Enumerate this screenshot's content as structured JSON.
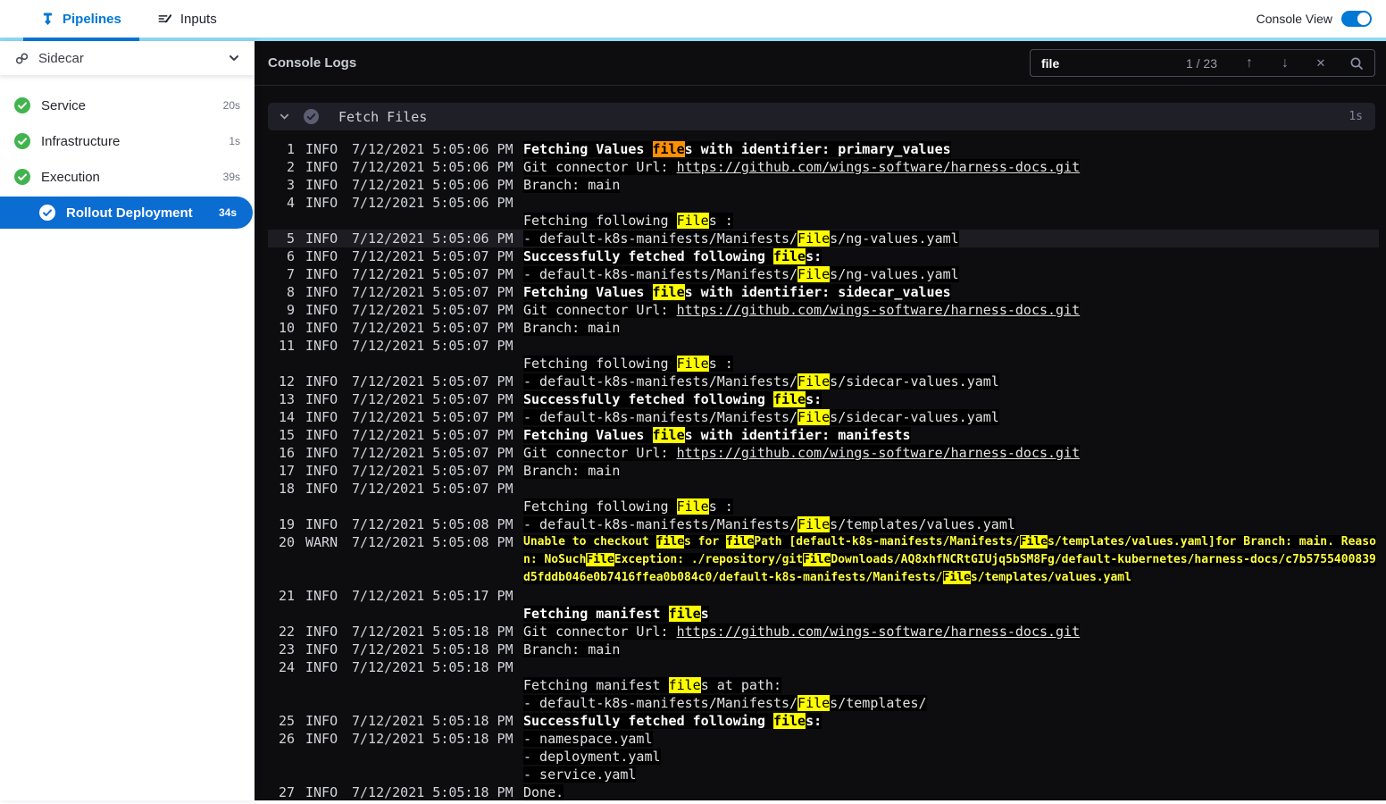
{
  "topbar": {
    "tabs": [
      {
        "label": "Pipelines",
        "active": true
      },
      {
        "label": "Inputs",
        "active": false
      }
    ],
    "console_view_label": "Console View",
    "console_view_on": true
  },
  "sidebar": {
    "group": {
      "label": "Sidecar"
    },
    "items": [
      {
        "label": "Service",
        "duration": "20s",
        "status": "success"
      },
      {
        "label": "Infrastructure",
        "duration": "1s",
        "status": "success"
      },
      {
        "label": "Execution",
        "duration": "39s",
        "status": "success"
      }
    ],
    "selected_item": {
      "label": "Rollout Deployment",
      "duration": "34s",
      "status": "success"
    }
  },
  "console": {
    "title": "Console Logs",
    "search": {
      "value": "file",
      "count": "1 / 23"
    },
    "section": {
      "title": "Fetch Files",
      "duration": "1s"
    },
    "colors": {
      "accent": "#0278d5",
      "tab_underline": "#8ed9f7",
      "pill": "#0b6cd2",
      "success_green": "#42b44f",
      "console_bg": "#0d0d10",
      "section_bg": "#1e1f27",
      "match_bg": "#fdfd00",
      "current_match_bg": "#ff9100",
      "warn_text": "#ffff3f"
    },
    "rows": [
      {
        "n": 1,
        "lv": "INFO",
        "t": "7/12/2021 5:05:06 PM",
        "b": true,
        "ls": [
          [
            {
              "x": "Fetching Values "
            },
            {
              "x": "file",
              "h": "c"
            },
            {
              "x": "s with identifier: primary_values"
            }
          ]
        ]
      },
      {
        "n": 2,
        "lv": "INFO",
        "t": "7/12/2021 5:05:06 PM",
        "ls": [
          [
            {
              "x": "Git connector Url: "
            },
            {
              "x": "https://github.com/wings-software/harness-docs.git",
              "u": true
            }
          ]
        ]
      },
      {
        "n": 3,
        "lv": "INFO",
        "t": "7/12/2021 5:05:06 PM",
        "ls": [
          [
            {
              "x": "Branch: main"
            }
          ]
        ]
      },
      {
        "n": 4,
        "lv": "INFO",
        "t": "7/12/2021 5:05:06 PM",
        "ls": [
          [],
          [
            {
              "x": "Fetching following "
            },
            {
              "x": "File",
              "h": "m"
            },
            {
              "x": "s :"
            }
          ]
        ]
      },
      {
        "n": 5,
        "lv": "INFO",
        "t": "7/12/2021 5:05:06 PM",
        "sel": true,
        "ls": [
          [
            {
              "x": "- default-k8s-manifests/Manifests/"
            },
            {
              "x": "File",
              "h": "m"
            },
            {
              "x": "s/ng-values.yaml"
            }
          ]
        ]
      },
      {
        "n": 6,
        "lv": "INFO",
        "t": "7/12/2021 5:05:07 PM",
        "b": true,
        "ls": [
          [
            {
              "x": "Successfully fetched following "
            },
            {
              "x": "file",
              "h": "m"
            },
            {
              "x": "s:"
            }
          ]
        ]
      },
      {
        "n": 7,
        "lv": "INFO",
        "t": "7/12/2021 5:05:07 PM",
        "ls": [
          [
            {
              "x": "- default-k8s-manifests/Manifests/"
            },
            {
              "x": "File",
              "h": "m"
            },
            {
              "x": "s/ng-values.yaml"
            }
          ]
        ]
      },
      {
        "n": 8,
        "lv": "INFO",
        "t": "7/12/2021 5:05:07 PM",
        "b": true,
        "ls": [
          [
            {
              "x": "Fetching Values "
            },
            {
              "x": "file",
              "h": "m"
            },
            {
              "x": "s with identifier: sidecar_values"
            }
          ]
        ]
      },
      {
        "n": 9,
        "lv": "INFO",
        "t": "7/12/2021 5:05:07 PM",
        "ls": [
          [
            {
              "x": "Git connector Url: "
            },
            {
              "x": "https://github.com/wings-software/harness-docs.git",
              "u": true
            }
          ]
        ]
      },
      {
        "n": 10,
        "lv": "INFO",
        "t": "7/12/2021 5:05:07 PM",
        "ls": [
          [
            {
              "x": "Branch: main"
            }
          ]
        ]
      },
      {
        "n": 11,
        "lv": "INFO",
        "t": "7/12/2021 5:05:07 PM",
        "ls": [
          [],
          [
            {
              "x": "Fetching following "
            },
            {
              "x": "File",
              "h": "m"
            },
            {
              "x": "s :"
            }
          ]
        ]
      },
      {
        "n": 12,
        "lv": "INFO",
        "t": "7/12/2021 5:05:07 PM",
        "ls": [
          [
            {
              "x": "- default-k8s-manifests/Manifests/"
            },
            {
              "x": "File",
              "h": "m"
            },
            {
              "x": "s/sidecar-values.yaml"
            }
          ]
        ]
      },
      {
        "n": 13,
        "lv": "INFO",
        "t": "7/12/2021 5:05:07 PM",
        "b": true,
        "ls": [
          [
            {
              "x": "Successfully fetched following "
            },
            {
              "x": "file",
              "h": "m"
            },
            {
              "x": "s:"
            }
          ]
        ]
      },
      {
        "n": 14,
        "lv": "INFO",
        "t": "7/12/2021 5:05:07 PM",
        "ls": [
          [
            {
              "x": "- default-k8s-manifests/Manifests/"
            },
            {
              "x": "File",
              "h": "m"
            },
            {
              "x": "s/sidecar-values.yaml"
            }
          ]
        ]
      },
      {
        "n": 15,
        "lv": "INFO",
        "t": "7/12/2021 5:05:07 PM",
        "b": true,
        "ls": [
          [
            {
              "x": "Fetching Values "
            },
            {
              "x": "file",
              "h": "m"
            },
            {
              "x": "s with identifier: manifests"
            }
          ]
        ]
      },
      {
        "n": 16,
        "lv": "INFO",
        "t": "7/12/2021 5:05:07 PM",
        "ls": [
          [
            {
              "x": "Git connector Url: "
            },
            {
              "x": "https://github.com/wings-software/harness-docs.git",
              "u": true
            }
          ]
        ]
      },
      {
        "n": 17,
        "lv": "INFO",
        "t": "7/12/2021 5:05:07 PM",
        "ls": [
          [
            {
              "x": "Branch: main"
            }
          ]
        ]
      },
      {
        "n": 18,
        "lv": "INFO",
        "t": "7/12/2021 5:05:07 PM",
        "ls": [
          [],
          [
            {
              "x": "Fetching following "
            },
            {
              "x": "File",
              "h": "m"
            },
            {
              "x": "s :"
            }
          ]
        ]
      },
      {
        "n": 19,
        "lv": "INFO",
        "t": "7/12/2021 5:05:08 PM",
        "ls": [
          [
            {
              "x": "- default-k8s-manifests/Manifests/"
            },
            {
              "x": "File",
              "h": "m"
            },
            {
              "x": "s/templates/values.yaml"
            }
          ]
        ]
      },
      {
        "n": 20,
        "lv": "WARN",
        "t": "7/12/2021 5:05:08 PM",
        "w": true,
        "ls": [
          [
            {
              "x": "Unable to checkout "
            },
            {
              "x": "file",
              "h": "m"
            },
            {
              "x": "s for "
            },
            {
              "x": "file",
              "h": "m"
            },
            {
              "x": "Path [default-k8s-manifests/Manifests/"
            },
            {
              "x": "File",
              "h": "m"
            },
            {
              "x": "s/templates/values.yaml]for Branch: main. Reason: NoSuch"
            },
            {
              "x": "File",
              "h": "m"
            },
            {
              "x": "Exception: ./repository/git"
            },
            {
              "x": "File",
              "h": "m"
            },
            {
              "x": "Downloads/AQ8xhfNCRtGIUjq5bSM8Fg/default-kubernetes/harness-docs/c7b5755400839d5fddb046e0b7416ffea0b084c0/default-k8s-manifests/Manifests/"
            },
            {
              "x": "File",
              "h": "m"
            },
            {
              "x": "s/templates/values.yaml"
            }
          ]
        ]
      },
      {
        "n": 21,
        "lv": "INFO",
        "t": "7/12/2021 5:05:17 PM",
        "b": true,
        "ls": [
          [],
          [
            {
              "x": "Fetching manifest "
            },
            {
              "x": "file",
              "h": "m"
            },
            {
              "x": "s"
            }
          ]
        ]
      },
      {
        "n": 22,
        "lv": "INFO",
        "t": "7/12/2021 5:05:18 PM",
        "ls": [
          [
            {
              "x": "Git connector Url: "
            },
            {
              "x": "https://github.com/wings-software/harness-docs.git",
              "u": true
            }
          ]
        ]
      },
      {
        "n": 23,
        "lv": "INFO",
        "t": "7/12/2021 5:05:18 PM",
        "ls": [
          [
            {
              "x": "Branch: main"
            }
          ]
        ]
      },
      {
        "n": 24,
        "lv": "INFO",
        "t": "7/12/2021 5:05:18 PM",
        "ls": [
          [],
          [
            {
              "x": "Fetching manifest "
            },
            {
              "x": "file",
              "h": "m"
            },
            {
              "x": "s at path:"
            }
          ],
          [
            {
              "x": "- default-k8s-manifests/Manifests/"
            },
            {
              "x": "File",
              "h": "m"
            },
            {
              "x": "s/templates/"
            }
          ]
        ]
      },
      {
        "n": 25,
        "lv": "INFO",
        "t": "7/12/2021 5:05:18 PM",
        "b": true,
        "ls": [
          [
            {
              "x": "Successfully fetched following "
            },
            {
              "x": "file",
              "h": "m"
            },
            {
              "x": "s:"
            }
          ]
        ]
      },
      {
        "n": 26,
        "lv": "INFO",
        "t": "7/12/2021 5:05:18 PM",
        "ls": [
          [
            {
              "x": "- namespace.yaml"
            }
          ],
          [
            {
              "x": "- deployment.yaml"
            }
          ],
          [
            {
              "x": "- service.yaml"
            }
          ]
        ]
      },
      {
        "n": 27,
        "lv": "INFO",
        "t": "7/12/2021 5:05:18 PM",
        "ls": [
          [
            {
              "x": "Done."
            }
          ]
        ]
      }
    ]
  }
}
